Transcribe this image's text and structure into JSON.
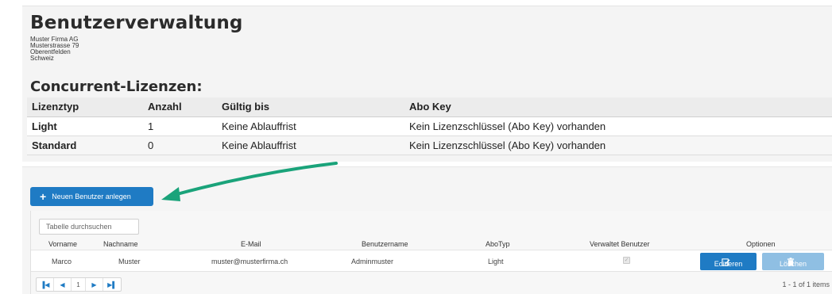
{
  "header": {
    "title": "Benutzerverwaltung",
    "address": [
      "Muster Firma AG",
      "Musterstrasse 79",
      "Oberentfelden",
      "Schweiz"
    ]
  },
  "licenses": {
    "title": "Concurrent-Lizenzen:",
    "columns": [
      "Lizenztyp",
      "Anzahl",
      "Gültig bis",
      "Abo Key"
    ],
    "rows": [
      [
        "Light",
        "1",
        "Keine Ablauffrist",
        "Kein Lizenzschlüssel (Abo Key) vorhanden"
      ],
      [
        "Standard",
        "0",
        "Keine Ablauffrist",
        "Kein Lizenzschlüssel (Abo Key) vorhanden"
      ]
    ]
  },
  "toolbar": {
    "new_user_label": "Neuen Benutzer anlegen"
  },
  "grid": {
    "search_placeholder": "Tabelle durchsuchen",
    "columns": [
      "Vorname",
      "Nachname",
      "E-Mail",
      "Benutzername",
      "AboTyp",
      "Verwaltet Benutzer",
      "Optionen"
    ],
    "rows": [
      {
        "vorname": "Marco",
        "nachname": "Muster",
        "email": "muster@musterfirma.ch",
        "benutzername": "Adminmuster",
        "abotyp": "Light",
        "verwaltet": true
      }
    ],
    "edit_label": "Editieren",
    "delete_label": "Löschen",
    "pager": {
      "current_page": "1",
      "info": "1 - 1 of 1 items"
    }
  },
  "colors": {
    "primary": "#1f7bc4",
    "primary_disabled": "#8fbfe3",
    "arrow": "#1aa37a"
  }
}
